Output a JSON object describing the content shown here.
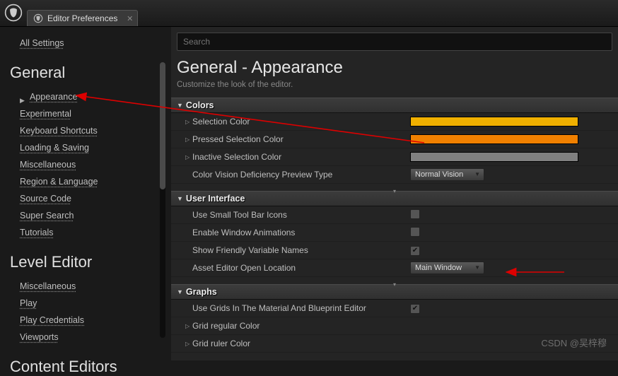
{
  "tab": {
    "title": "Editor Preferences"
  },
  "sidebar": {
    "all_settings": "All Settings",
    "categories": [
      {
        "title": "General",
        "items": [
          "Appearance",
          "Experimental",
          "Keyboard Shortcuts",
          "Loading & Saving",
          "Miscellaneous",
          "Region & Language",
          "Source Code",
          "Super Search",
          "Tutorials"
        ]
      },
      {
        "title": "Level Editor",
        "items": [
          "Miscellaneous",
          "Play",
          "Play Credentials",
          "Viewports"
        ]
      },
      {
        "title": "Content Editors",
        "items": []
      }
    ]
  },
  "search": {
    "placeholder": "Search"
  },
  "page": {
    "title": "General - Appearance",
    "subtitle": "Customize the look of the editor."
  },
  "sections": {
    "colors": {
      "header": "Colors",
      "rows": [
        {
          "label": "Selection Color",
          "color": "#f0b000"
        },
        {
          "label": "Pressed Selection Color",
          "color": "#f08000"
        },
        {
          "label": "Inactive Selection Color",
          "color": "#808080"
        }
      ],
      "cvd": {
        "label": "Color Vision Deficiency Preview Type",
        "value": "Normal Vision"
      }
    },
    "ui": {
      "header": "User Interface",
      "small_icons": {
        "label": "Use Small Tool Bar Icons",
        "checked": false
      },
      "enable_anim": {
        "label": "Enable Window Animations",
        "checked": false
      },
      "friendly": {
        "label": "Show Friendly Variable Names",
        "checked": true
      },
      "open_loc": {
        "label": "Asset Editor Open Location",
        "value": "Main Window"
      }
    },
    "graphs": {
      "header": "Graphs",
      "use_grids": {
        "label": "Use Grids In The Material And Blueprint Editor",
        "checked": true
      },
      "reg_color": {
        "label": "Grid regular Color"
      },
      "ruler_color": {
        "label": "Grid ruler Color"
      }
    }
  },
  "watermark": "CSDN @吴梓穆"
}
